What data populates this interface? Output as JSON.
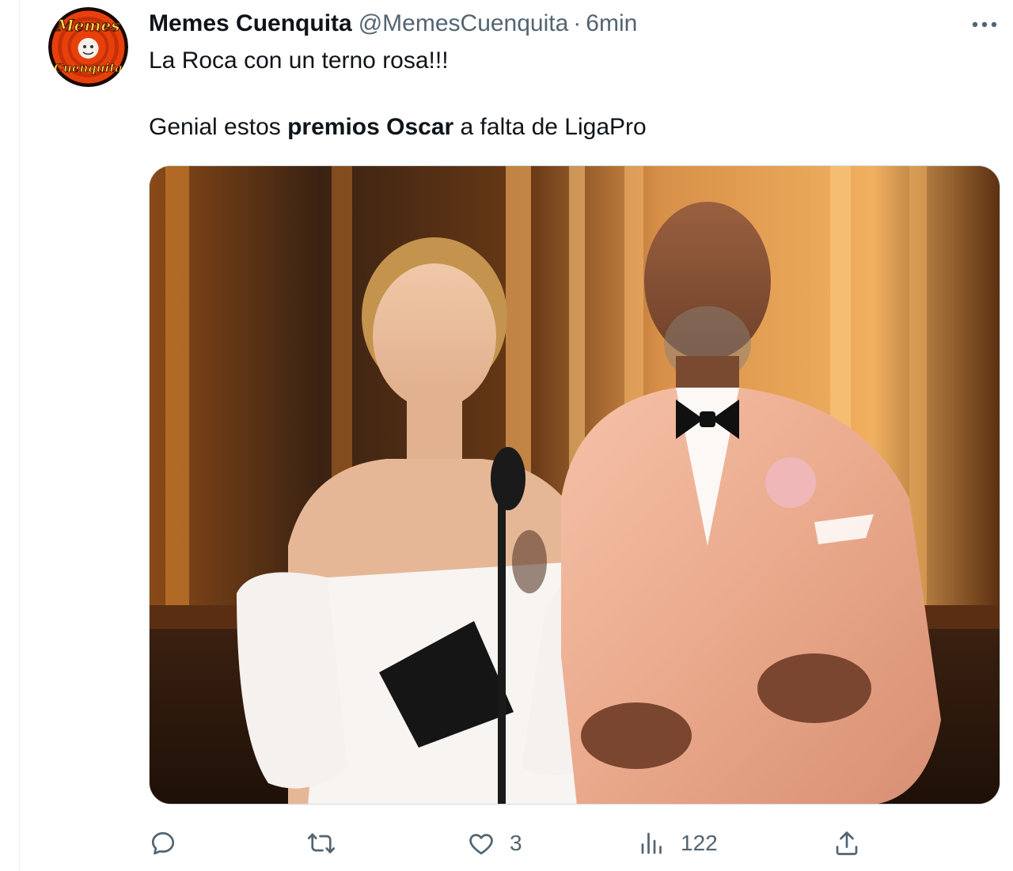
{
  "author": {
    "name": "Memes Cuenquita",
    "handle": "@MemesCuenquita",
    "separator": "·",
    "time": "6min",
    "avatar_text_top": "Memes",
    "avatar_text_bottom": "Cuenquita"
  },
  "tweet": {
    "line1": "La Roca con un terno rosa!!!",
    "line2_before": "Genial estos ",
    "line2_bold": "premios Oscar",
    "line2_after": " a falta de LigaPro"
  },
  "actions": {
    "reply_count": "",
    "retweet_count": "",
    "like_count": "3",
    "views_count": "122"
  },
  "icons": {
    "more": "more-horizontal-icon",
    "reply": "reply-icon",
    "retweet": "retweet-icon",
    "like": "heart-icon",
    "views": "views-chart-icon",
    "share": "share-icon"
  },
  "colors": {
    "text": "#0f1419",
    "secondary": "#536471",
    "border": "#cfd9de",
    "avatar_bg": "#e8400c"
  }
}
